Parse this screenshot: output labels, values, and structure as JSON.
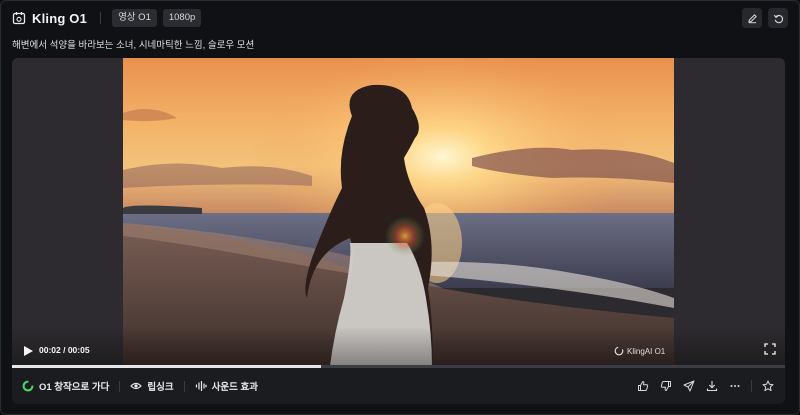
{
  "header": {
    "title": "Kling O1",
    "chips": [
      "영상 O1",
      "1080p"
    ],
    "icons": [
      "app-logo-icon",
      "edit-icon",
      "undo-icon"
    ]
  },
  "prompt": "해변에서 석양을 바라보는 소녀, 시네마틱한 느낌, 슬로우 모션",
  "player": {
    "time": "00:02 / 00:05",
    "watermark": "KlingAI O1",
    "progress": 0.4,
    "icons": [
      "play-icon",
      "fullscreen-icon"
    ]
  },
  "footer": {
    "actions": [
      {
        "label": "O1 창작으로 가다",
        "icon": "kling-logo-icon"
      },
      {
        "label": "립싱크",
        "icon": "eye-icon"
      },
      {
        "label": "사운드 효과",
        "icon": "sound-wave-icon"
      }
    ],
    "icon_buttons": [
      "thumbs-up-icon",
      "thumbs-down-icon",
      "share-icon",
      "download-icon",
      "more-icon",
      "star-icon"
    ]
  },
  "colors": {
    "background": "#101114",
    "panel": "#1b1c20",
    "accent_green": "#4cd964"
  }
}
